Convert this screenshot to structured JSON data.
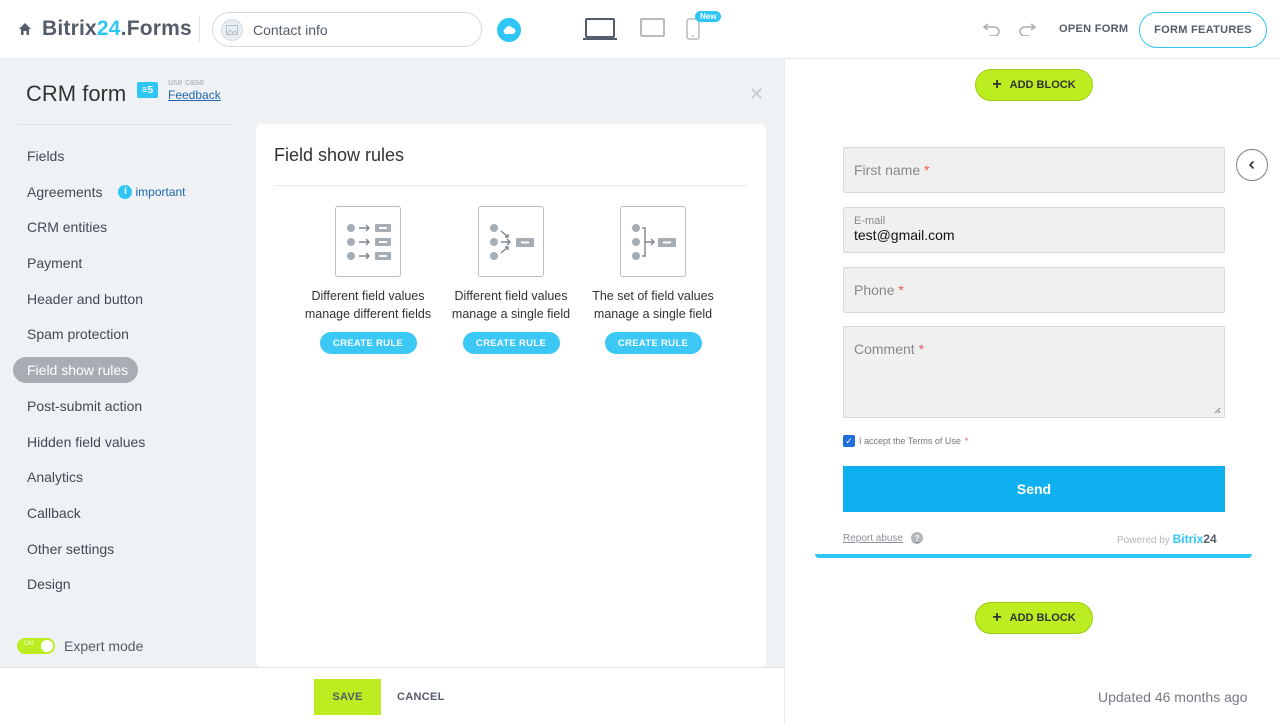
{
  "header": {
    "brand_main": "Bitrix",
    "brand_accent": "24",
    "brand_suffix": ".Forms",
    "site_name": "Contact info",
    "new_badge": "New",
    "open_form_label": "OPEN FORM",
    "form_features_label": "FORM FEATURES",
    "icons": [
      "home-icon",
      "cloud-icon",
      "desktop-icon",
      "tablet-icon",
      "mobile-icon",
      "undo-icon",
      "redo-icon"
    ],
    "accent_color": "#2fc6f6"
  },
  "sidebar": {
    "title": "CRM form",
    "use_case_label": "use case",
    "use_case_value": "Feedback",
    "important_label": "important",
    "items": [
      {
        "label": "Fields"
      },
      {
        "label": "Agreements"
      },
      {
        "label": "CRM entities"
      },
      {
        "label": "Payment"
      },
      {
        "label": "Header and button"
      },
      {
        "label": "Spam protection"
      },
      {
        "label": "Field show rules",
        "active": true
      },
      {
        "label": "Post-submit action"
      },
      {
        "label": "Hidden field values"
      },
      {
        "label": "Analytics"
      },
      {
        "label": "Callback"
      },
      {
        "label": "Other settings"
      },
      {
        "label": "Design"
      }
    ],
    "expert_mode_label": "Expert mode",
    "expert_mode_toggle": "ON",
    "expert_mode_on": true
  },
  "main": {
    "title": "Field show rules",
    "rules": [
      {
        "line1": "Different field values",
        "line2": "manage different fields",
        "button": "CREATE RULE"
      },
      {
        "line1": "Different field values",
        "line2": "manage a single field",
        "button": "CREATE RULE"
      },
      {
        "line1": "The set of field values",
        "line2": "manage a single field",
        "button": "CREATE RULE"
      }
    ]
  },
  "footer": {
    "save_label": "SAVE",
    "cancel_label": "CANCEL"
  },
  "preview": {
    "add_block_label": "ADD BLOCK",
    "fields": {
      "first_name": {
        "label": "First name",
        "required_mark": "*"
      },
      "email": {
        "label": "E-mail",
        "value": "test@gmail.com"
      },
      "phone": {
        "label": "Phone",
        "required_mark": "*"
      },
      "comment": {
        "label": "Comment",
        "required_mark": "*"
      }
    },
    "terms_label": "I accept the Terms of Use",
    "terms_required_mark": "*",
    "terms_checked": true,
    "send_label": "Send",
    "report_abuse": "Report abuse",
    "help_mark": "?",
    "powered_by": "Powered by",
    "powered_brand": "Bitrix",
    "powered_num": "24",
    "updated_text": "Updated 46 months ago"
  }
}
